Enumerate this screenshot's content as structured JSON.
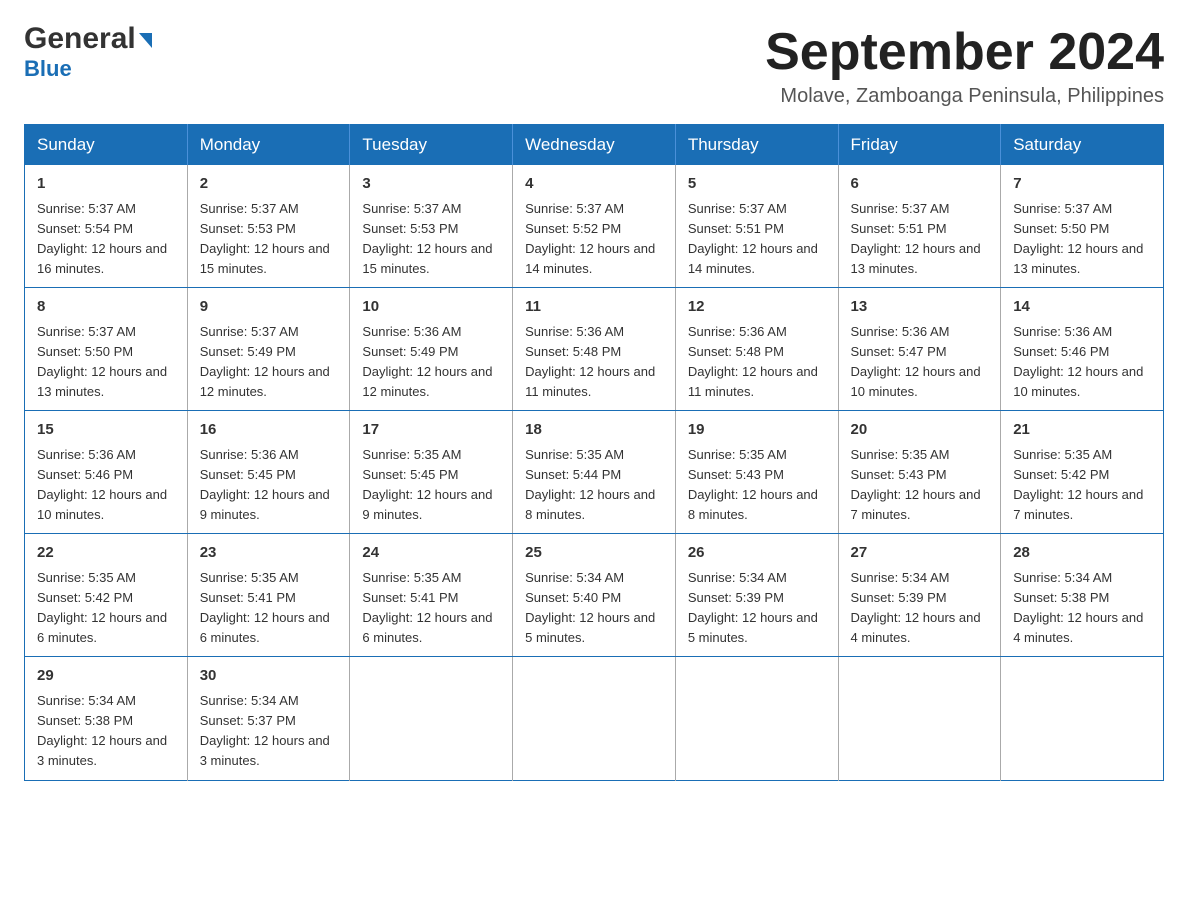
{
  "logo": {
    "line1": "General",
    "line2": "Blue"
  },
  "header": {
    "month": "September 2024",
    "location": "Molave, Zamboanga Peninsula, Philippines"
  },
  "weekdays": [
    "Sunday",
    "Monday",
    "Tuesday",
    "Wednesday",
    "Thursday",
    "Friday",
    "Saturday"
  ],
  "weeks": [
    [
      {
        "day": "1",
        "sunrise": "Sunrise: 5:37 AM",
        "sunset": "Sunset: 5:54 PM",
        "daylight": "Daylight: 12 hours and 16 minutes."
      },
      {
        "day": "2",
        "sunrise": "Sunrise: 5:37 AM",
        "sunset": "Sunset: 5:53 PM",
        "daylight": "Daylight: 12 hours and 15 minutes."
      },
      {
        "day": "3",
        "sunrise": "Sunrise: 5:37 AM",
        "sunset": "Sunset: 5:53 PM",
        "daylight": "Daylight: 12 hours and 15 minutes."
      },
      {
        "day": "4",
        "sunrise": "Sunrise: 5:37 AM",
        "sunset": "Sunset: 5:52 PM",
        "daylight": "Daylight: 12 hours and 14 minutes."
      },
      {
        "day": "5",
        "sunrise": "Sunrise: 5:37 AM",
        "sunset": "Sunset: 5:51 PM",
        "daylight": "Daylight: 12 hours and 14 minutes."
      },
      {
        "day": "6",
        "sunrise": "Sunrise: 5:37 AM",
        "sunset": "Sunset: 5:51 PM",
        "daylight": "Daylight: 12 hours and 13 minutes."
      },
      {
        "day": "7",
        "sunrise": "Sunrise: 5:37 AM",
        "sunset": "Sunset: 5:50 PM",
        "daylight": "Daylight: 12 hours and 13 minutes."
      }
    ],
    [
      {
        "day": "8",
        "sunrise": "Sunrise: 5:37 AM",
        "sunset": "Sunset: 5:50 PM",
        "daylight": "Daylight: 12 hours and 13 minutes."
      },
      {
        "day": "9",
        "sunrise": "Sunrise: 5:37 AM",
        "sunset": "Sunset: 5:49 PM",
        "daylight": "Daylight: 12 hours and 12 minutes."
      },
      {
        "day": "10",
        "sunrise": "Sunrise: 5:36 AM",
        "sunset": "Sunset: 5:49 PM",
        "daylight": "Daylight: 12 hours and 12 minutes."
      },
      {
        "day": "11",
        "sunrise": "Sunrise: 5:36 AM",
        "sunset": "Sunset: 5:48 PM",
        "daylight": "Daylight: 12 hours and 11 minutes."
      },
      {
        "day": "12",
        "sunrise": "Sunrise: 5:36 AM",
        "sunset": "Sunset: 5:48 PM",
        "daylight": "Daylight: 12 hours and 11 minutes."
      },
      {
        "day": "13",
        "sunrise": "Sunrise: 5:36 AM",
        "sunset": "Sunset: 5:47 PM",
        "daylight": "Daylight: 12 hours and 10 minutes."
      },
      {
        "day": "14",
        "sunrise": "Sunrise: 5:36 AM",
        "sunset": "Sunset: 5:46 PM",
        "daylight": "Daylight: 12 hours and 10 minutes."
      }
    ],
    [
      {
        "day": "15",
        "sunrise": "Sunrise: 5:36 AM",
        "sunset": "Sunset: 5:46 PM",
        "daylight": "Daylight: 12 hours and 10 minutes."
      },
      {
        "day": "16",
        "sunrise": "Sunrise: 5:36 AM",
        "sunset": "Sunset: 5:45 PM",
        "daylight": "Daylight: 12 hours and 9 minutes."
      },
      {
        "day": "17",
        "sunrise": "Sunrise: 5:35 AM",
        "sunset": "Sunset: 5:45 PM",
        "daylight": "Daylight: 12 hours and 9 minutes."
      },
      {
        "day": "18",
        "sunrise": "Sunrise: 5:35 AM",
        "sunset": "Sunset: 5:44 PM",
        "daylight": "Daylight: 12 hours and 8 minutes."
      },
      {
        "day": "19",
        "sunrise": "Sunrise: 5:35 AM",
        "sunset": "Sunset: 5:43 PM",
        "daylight": "Daylight: 12 hours and 8 minutes."
      },
      {
        "day": "20",
        "sunrise": "Sunrise: 5:35 AM",
        "sunset": "Sunset: 5:43 PM",
        "daylight": "Daylight: 12 hours and 7 minutes."
      },
      {
        "day": "21",
        "sunrise": "Sunrise: 5:35 AM",
        "sunset": "Sunset: 5:42 PM",
        "daylight": "Daylight: 12 hours and 7 minutes."
      }
    ],
    [
      {
        "day": "22",
        "sunrise": "Sunrise: 5:35 AM",
        "sunset": "Sunset: 5:42 PM",
        "daylight": "Daylight: 12 hours and 6 minutes."
      },
      {
        "day": "23",
        "sunrise": "Sunrise: 5:35 AM",
        "sunset": "Sunset: 5:41 PM",
        "daylight": "Daylight: 12 hours and 6 minutes."
      },
      {
        "day": "24",
        "sunrise": "Sunrise: 5:35 AM",
        "sunset": "Sunset: 5:41 PM",
        "daylight": "Daylight: 12 hours and 6 minutes."
      },
      {
        "day": "25",
        "sunrise": "Sunrise: 5:34 AM",
        "sunset": "Sunset: 5:40 PM",
        "daylight": "Daylight: 12 hours and 5 minutes."
      },
      {
        "day": "26",
        "sunrise": "Sunrise: 5:34 AM",
        "sunset": "Sunset: 5:39 PM",
        "daylight": "Daylight: 12 hours and 5 minutes."
      },
      {
        "day": "27",
        "sunrise": "Sunrise: 5:34 AM",
        "sunset": "Sunset: 5:39 PM",
        "daylight": "Daylight: 12 hours and 4 minutes."
      },
      {
        "day": "28",
        "sunrise": "Sunrise: 5:34 AM",
        "sunset": "Sunset: 5:38 PM",
        "daylight": "Daylight: 12 hours and 4 minutes."
      }
    ],
    [
      {
        "day": "29",
        "sunrise": "Sunrise: 5:34 AM",
        "sunset": "Sunset: 5:38 PM",
        "daylight": "Daylight: 12 hours and 3 minutes."
      },
      {
        "day": "30",
        "sunrise": "Sunrise: 5:34 AM",
        "sunset": "Sunset: 5:37 PM",
        "daylight": "Daylight: 12 hours and 3 minutes."
      },
      null,
      null,
      null,
      null,
      null
    ]
  ]
}
